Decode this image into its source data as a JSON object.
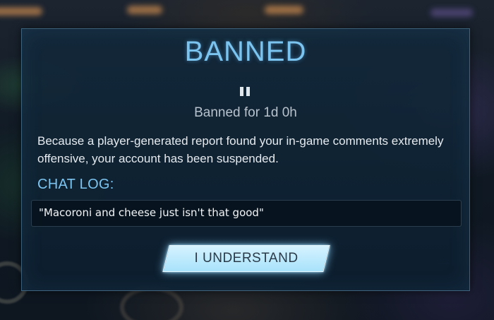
{
  "dialog": {
    "title": "BANNED",
    "pause_icon": "pause-icon",
    "duration": "Banned for 1d 0h",
    "message": "Because a player-generated report found your in-game comments extremely offensive, your account has been suspended.",
    "chat_heading": "CHAT LOG:",
    "chat_log": "\"Macoroni and cheese just isn't that good\"",
    "button_label": "I UNDERSTAND"
  },
  "colors": {
    "accent": "#7cc4f0",
    "button": "#bfeaff",
    "panel": "#12283a"
  }
}
